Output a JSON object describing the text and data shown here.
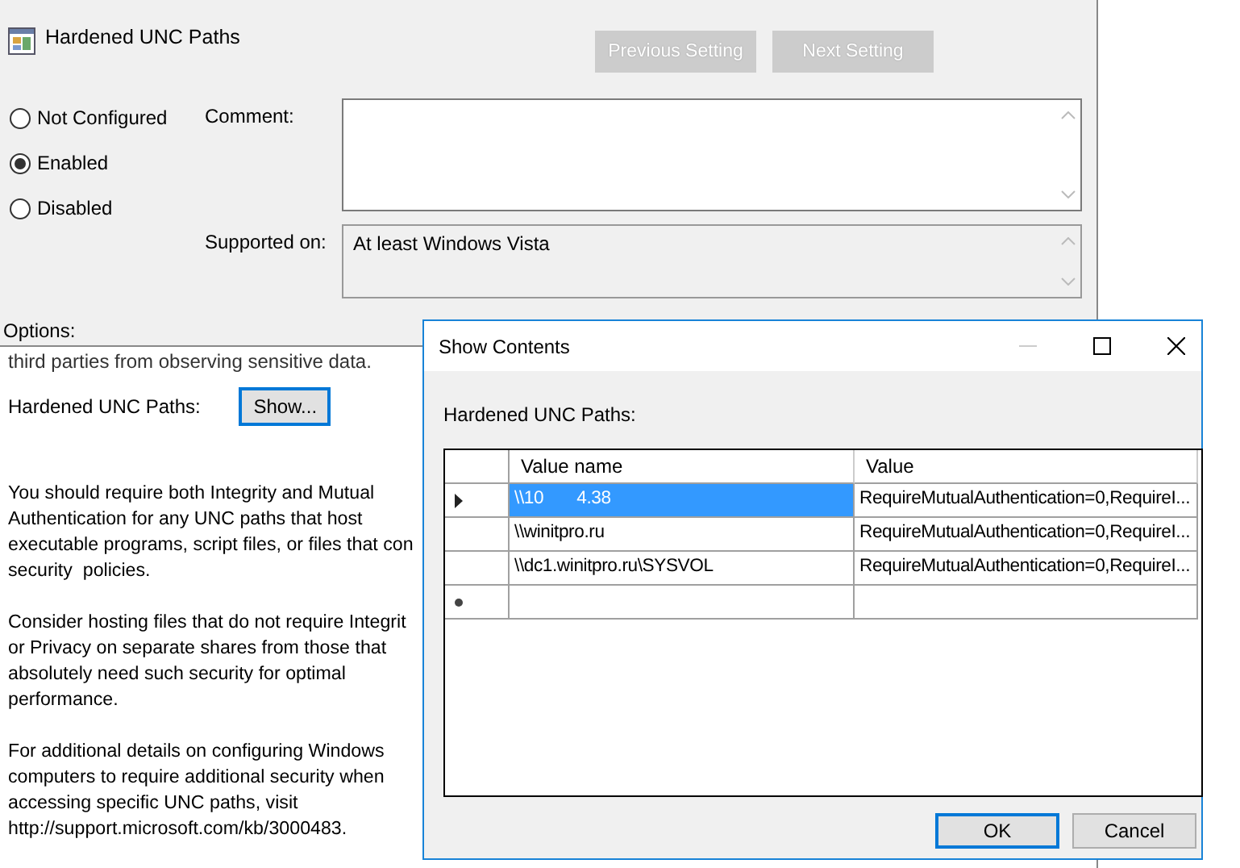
{
  "window": {
    "title": "Hardened UNC Paths"
  },
  "nav_buttons": [
    {
      "label": "Previous Setting",
      "disabled": true
    },
    {
      "label": "Next Setting",
      "disabled": true
    }
  ],
  "state_options": [
    {
      "label": "Not Configured",
      "selected": false
    },
    {
      "label": "Enabled",
      "selected": true
    },
    {
      "label": "Disabled",
      "selected": false
    }
  ],
  "comment": {
    "label": "Comment:"
  },
  "supported_on": {
    "label": "Supported on:",
    "value": "At least Windows Vista"
  },
  "options_label": "Options:",
  "options": {
    "cut_line": "third parties from observing sensitive data.",
    "field_label": "Hardened UNC Paths:",
    "button": "Show..."
  },
  "help": [
    "You should require both Integrity and Mutual\nAuthentication for any UNC paths that host\nexecutable programs, script files, or files that con\nsecurity  policies.",
    "Consider hosting files that do not require Integrit\nor Privacy on separate shares from those that\nabsolutely need such security for optimal\nperformance.",
    "For additional details on configuring Windows\ncomputers to require additional security when\naccessing specific UNC paths, visit\nhttp://support.microsoft.com/kb/3000483."
  ],
  "dialog": {
    "title": "Show Contents",
    "label": "Hardened UNC Paths:",
    "table": {
      "columns": [
        "Value name",
        "Value"
      ],
      "rows": [
        {
          "name": "\\\\10       4.38",
          "value": "RequireMutualAuthentication=0,RequireI...",
          "selected": true
        },
        {
          "name": "\\\\winitpro.ru",
          "value": "RequireMutualAuthentication=0,RequireI...",
          "selected": false
        },
        {
          "name": "\\\\dc1.winitpro.ru\\SYSVOL",
          "value": "RequireMutualAuthentication=0,RequireI...",
          "selected": false
        }
      ]
    },
    "buttons": [
      {
        "label": "OK",
        "default": true
      },
      {
        "label": "Cancel",
        "default": false
      }
    ]
  }
}
